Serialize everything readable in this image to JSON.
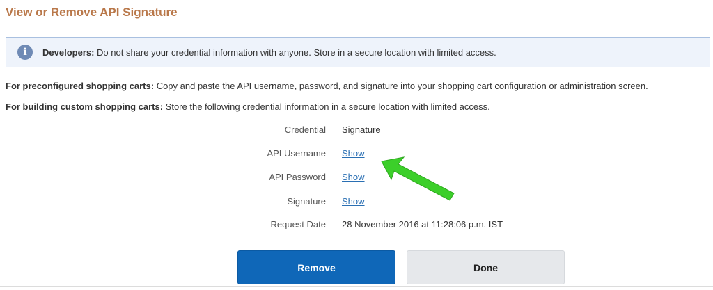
{
  "header": {
    "title": "View or Remove API Signature"
  },
  "notice": {
    "strong": "Developers:",
    "text": " Do not share your credential information with anyone. Store in a secure location with limited access.",
    "icon": "info-icon"
  },
  "instructions": {
    "preconfigured_strong": "For preconfigured shopping carts:",
    "preconfigured_text": " Copy and paste the API username, password, and signature into your shopping cart configuration or administration screen.",
    "custom_strong": "For building custom shopping carts:",
    "custom_text": " Store the following credential information in a secure location with limited access."
  },
  "credentials": {
    "credential_label": "Credential",
    "credential_value": "Signature",
    "username_label": "API Username",
    "username_link": "Show",
    "password_label": "API Password",
    "password_link": "Show",
    "signature_label": "Signature",
    "signature_link": "Show",
    "date_label": "Request Date",
    "date_value": "28 November 2016 at 11:28:06 p.m. IST"
  },
  "actions": {
    "remove_label": "Remove",
    "done_label": "Done"
  },
  "colors": {
    "title": "#b9784a",
    "link": "#2a6fb3",
    "primary_button": "#0f67b8",
    "secondary_button": "#e6e8eb",
    "annotation_arrow": "#3ccf2a"
  }
}
